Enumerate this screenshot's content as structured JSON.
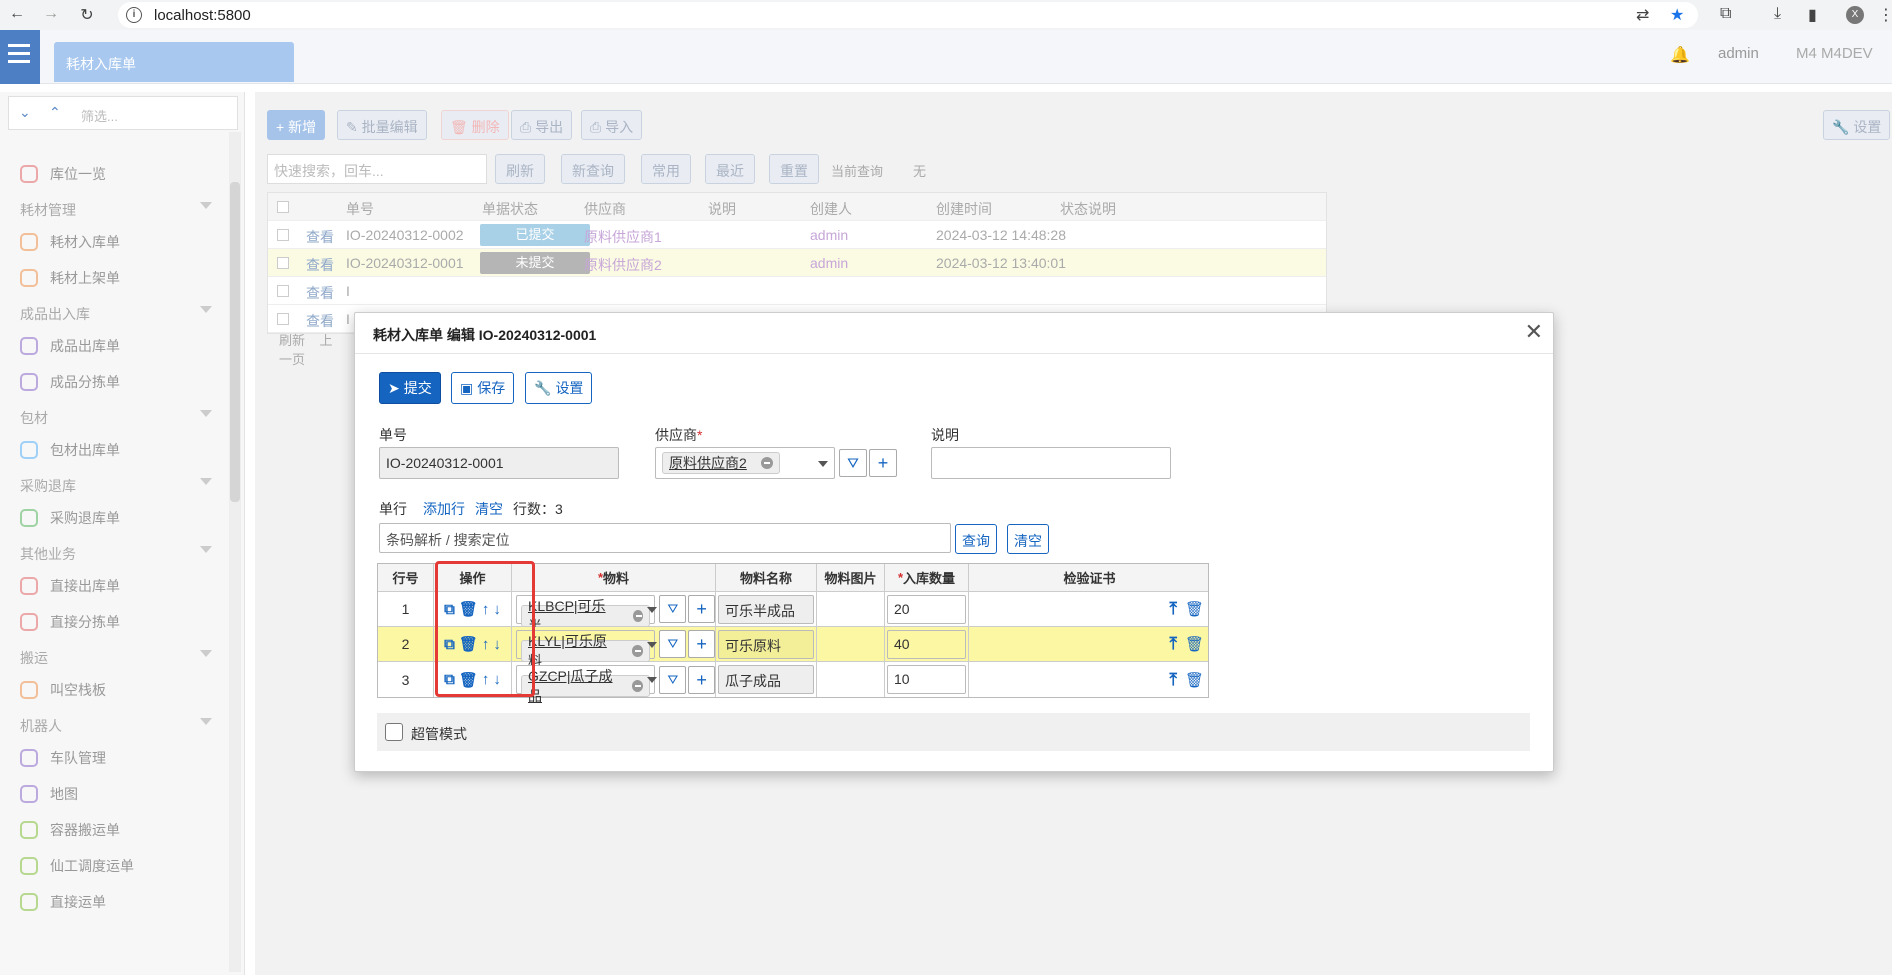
{
  "browser": {
    "url": "localhost:5800",
    "profile_initial": "X"
  },
  "topbar": {
    "tab_title": "耗材入库单",
    "user": "admin",
    "workspace": "M4 M4DEV"
  },
  "sidebar": {
    "search_placeholder": "筛选...",
    "items": [
      {
        "type": "item",
        "label": "库位一览",
        "color": "#e57373"
      },
      {
        "type": "group",
        "label": "耗材管理"
      },
      {
        "type": "item",
        "label": "耗材入库单",
        "color": "#ef9a5a"
      },
      {
        "type": "item",
        "label": "耗材上架单",
        "color": "#ef9a5a"
      },
      {
        "type": "group",
        "label": "成品出入库"
      },
      {
        "type": "item",
        "label": "成品出库单",
        "color": "#9575cd"
      },
      {
        "type": "item",
        "label": "成品分拣单",
        "color": "#9575cd"
      },
      {
        "type": "group",
        "label": "包材"
      },
      {
        "type": "item",
        "label": "包材出库单",
        "color": "#64b5f6"
      },
      {
        "type": "group",
        "label": "采购退库"
      },
      {
        "type": "item",
        "label": "采购退库单",
        "color": "#66bb6a"
      },
      {
        "type": "group",
        "label": "其他业务"
      },
      {
        "type": "item",
        "label": "直接出库单",
        "color": "#e57373"
      },
      {
        "type": "item",
        "label": "直接分拣单",
        "color": "#e57373"
      },
      {
        "type": "group",
        "label": "搬运"
      },
      {
        "type": "item",
        "label": "叫空栈板",
        "color": "#ef9a5a"
      },
      {
        "type": "group",
        "label": "机器人"
      },
      {
        "type": "item",
        "label": "车队管理",
        "color": "#9575cd"
      },
      {
        "type": "item",
        "label": "地图",
        "color": "#9575cd"
      },
      {
        "type": "item",
        "label": "容器搬运单",
        "color": "#8bc34a"
      },
      {
        "type": "item",
        "label": "仙工调度运单",
        "color": "#8bc34a"
      },
      {
        "type": "item",
        "label": "直接运单",
        "color": "#8bc34a"
      }
    ]
  },
  "list": {
    "toolbar": {
      "add": "新增",
      "batch_edit": "批量编辑",
      "delete": "删除",
      "export": "导出",
      "import": "导入",
      "settings": "设置"
    },
    "quick_search_placeholder": "快速搜索，回车...",
    "filters": {
      "refresh": "刷新",
      "new_query": "新查询",
      "common": "常用",
      "recent": "最近",
      "reset": "重置",
      "current_query_label": "当前查询",
      "current_query_value": "无"
    },
    "columns": [
      "单号",
      "单据状态",
      "供应商",
      "说明",
      "创建人",
      "创建时间",
      "状态说明"
    ],
    "view_label": "查看",
    "rows": [
      {
        "no": "IO-20240312-0002",
        "status": "已提交",
        "status_color": "#a8d0e6",
        "supplier": "原料供应商1",
        "creator": "admin",
        "time": "2024-03-12 14:48:28"
      },
      {
        "no": "IO-20240312-0001",
        "status": "未提交",
        "status_color": "#b5b5b5",
        "supplier": "原料供应商2",
        "creator": "admin",
        "time": "2024-03-12 13:40:01"
      },
      {
        "no": "I",
        "status": "",
        "status_color": "",
        "supplier": "",
        "creator": "",
        "time": ""
      },
      {
        "no": "I",
        "status": "",
        "status_color": "",
        "supplier": "",
        "creator": "",
        "time": ""
      }
    ],
    "pager": {
      "refresh": "刷新",
      "prev": "上一页"
    }
  },
  "modal": {
    "title": "耗材入库单 编辑 IO-20240312-0001",
    "buttons": {
      "submit": "提交",
      "save": "保存",
      "settings": "设置"
    },
    "fields": {
      "no_label": "单号",
      "no_value": "IO-20240312-0001",
      "supplier_label": "供应商",
      "supplier_value": "原料供应商2",
      "desc_label": "说明",
      "desc_value": ""
    },
    "lines": {
      "label": "单行",
      "add_row": "添加行",
      "clear": "清空",
      "count_label": "行数：",
      "count": "3",
      "barcode_placeholder": "条码解析 / 搜索定位",
      "query_btn": "查询",
      "clear_btn": "清空",
      "columns": {
        "line_no": "行号",
        "ops": "操作",
        "material": "物料",
        "material_name": "物料名称",
        "material_image": "物料图片",
        "qty": "入库数量",
        "cert": "检验证书"
      },
      "rows": [
        {
          "line": "1",
          "material": "KLBCP|可乐半...",
          "name": "可乐半成品",
          "qty": "20"
        },
        {
          "line": "2",
          "material": "KLYL|可乐原料",
          "name": "可乐原料",
          "qty": "40"
        },
        {
          "line": "3",
          "material": "GZCP|瓜子成品",
          "name": "瓜子成品",
          "qty": "10"
        }
      ]
    },
    "super_mode": "超管模式"
  }
}
